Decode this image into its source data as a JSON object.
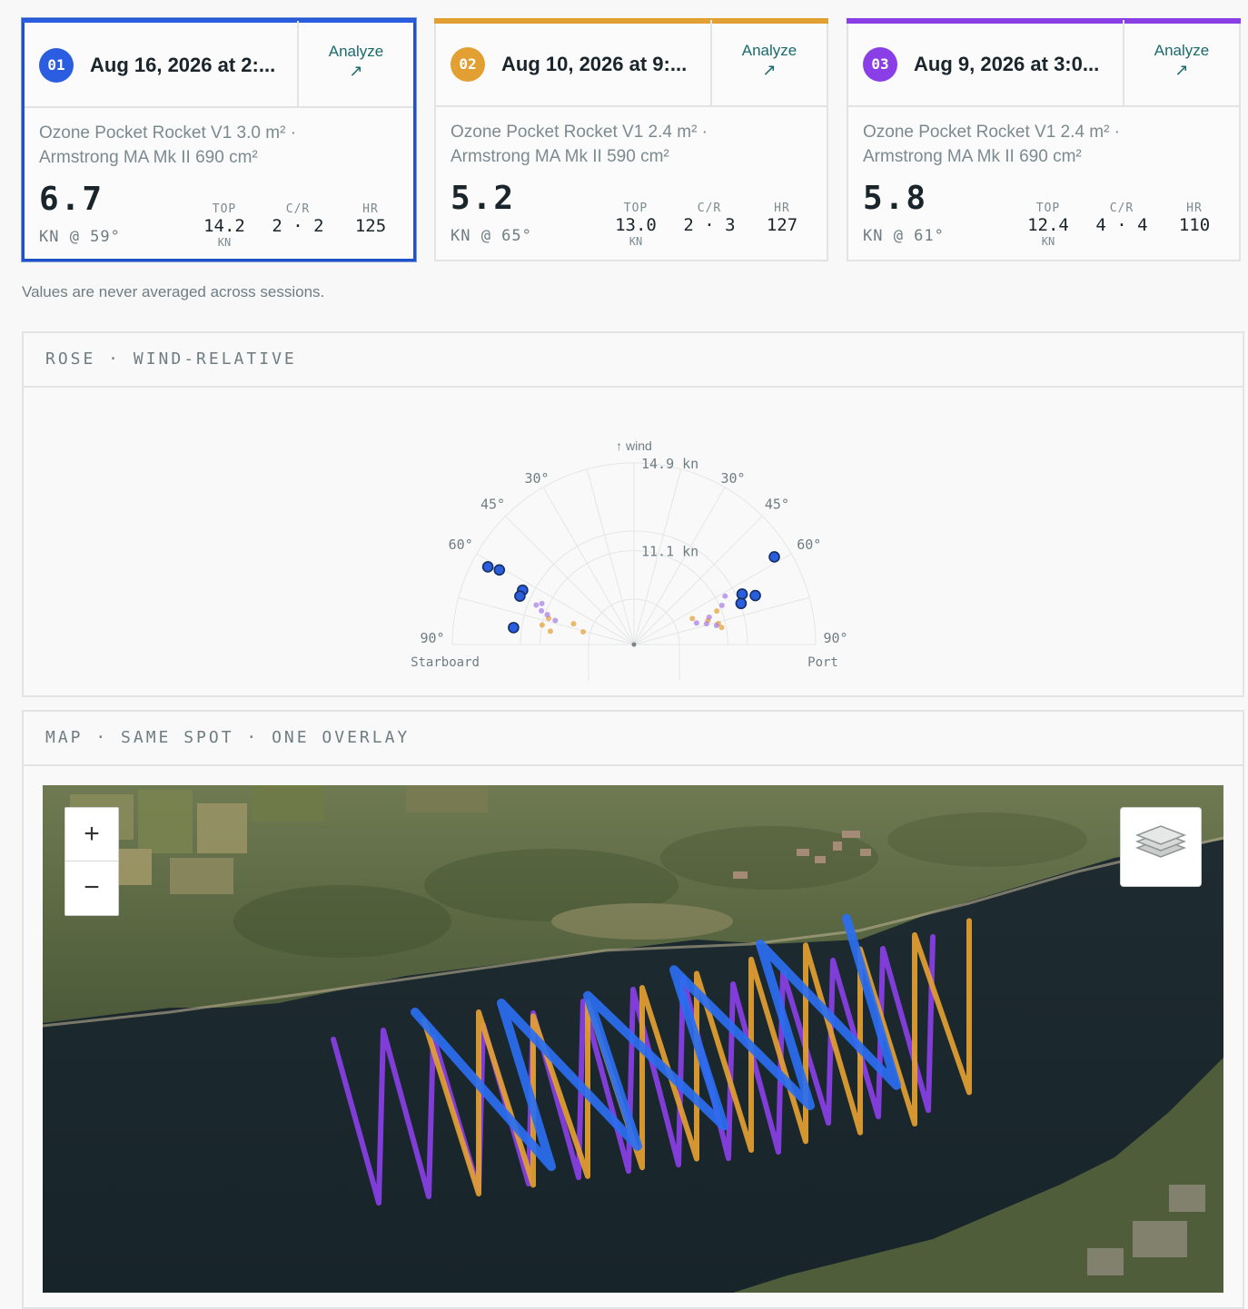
{
  "sessions": [
    {
      "num": "01",
      "date": "Aug 16, 2026 at 2:...",
      "analyze": "Analyze",
      "color": "#2a5de0",
      "gear_line1": "Ozone Pocket Rocket V1 3.0 m² ·",
      "gear_line2": "Armstrong MA Mk II 690 cm²",
      "speed": "6.7",
      "speed_sub": "KN @ 59°",
      "top_label": "TOP",
      "top_value": "14.2",
      "top_unit": "KN",
      "cr_label": "C/R",
      "cr_value": "2 · 2",
      "hr_label": "HR",
      "hr_value": "125",
      "selected": true
    },
    {
      "num": "02",
      "date": "Aug 10, 2026 at 9:...",
      "analyze": "Analyze",
      "color": "#e3a032",
      "gear_line1": "Ozone Pocket Rocket V1 2.4 m² ·",
      "gear_line2": "Armstrong MA Mk II 590 cm²",
      "speed": "5.2",
      "speed_sub": "KN @ 65°",
      "top_label": "TOP",
      "top_value": "13.0",
      "top_unit": "KN",
      "cr_label": "C/R",
      "cr_value": "2 · 3",
      "hr_label": "HR",
      "hr_value": "127",
      "selected": false
    },
    {
      "num": "03",
      "date": "Aug 9, 2026 at 3:0...",
      "analyze": "Analyze",
      "color": "#8a3fe6",
      "gear_line1": "Ozone Pocket Rocket V1 2.4 m² ·",
      "gear_line2": "Armstrong MA Mk II 690 cm²",
      "speed": "5.8",
      "speed_sub": "KN @ 61°",
      "top_label": "TOP",
      "top_value": "12.4",
      "top_unit": "KN",
      "cr_label": "C/R",
      "cr_value": "4 · 4",
      "hr_label": "HR",
      "hr_value": "110",
      "selected": false
    }
  ],
  "note": "Values are never averaged across sessions.",
  "rose": {
    "title": "ROSE · WIND-RELATIVE",
    "wind_label": "↑ wind",
    "ring_outer": "14.9 kn",
    "ring_inner": "11.1 kn",
    "angle_labels": [
      "30°",
      "45°",
      "60°",
      "90°"
    ],
    "starboard": "Starboard",
    "port": "Port"
  },
  "chart_data": {
    "type": "scatter",
    "title": "ROSE · WIND-RELATIVE",
    "angle_unit": "degrees off wind",
    "radial_unit": "kn",
    "radial_ticks": [
      11.1,
      14.9
    ],
    "series": [
      {
        "color": "#2a5de0",
        "points": [
          {
            "side": "starboard",
            "angle": 62,
            "speed": 14.2
          },
          {
            "side": "starboard",
            "angle": 61,
            "speed": 13.7
          },
          {
            "side": "starboard",
            "angle": 64,
            "speed": 12.4
          },
          {
            "side": "starboard",
            "angle": 67,
            "speed": 12.4
          },
          {
            "side": "starboard",
            "angle": 82,
            "speed": 12.3
          },
          {
            "side": "port",
            "angle": 58,
            "speed": 14.2
          },
          {
            "side": "port",
            "angle": 65,
            "speed": 12.2
          },
          {
            "side": "port",
            "angle": 68,
            "speed": 12.7
          },
          {
            "side": "port",
            "angle": 69,
            "speed": 12.0
          }
        ]
      },
      {
        "color": "#e3a032",
        "points": [
          {
            "side": "starboard",
            "angle": 73,
            "speed": 10.9
          },
          {
            "side": "starboard",
            "angle": 78,
            "speed": 11.1
          },
          {
            "side": "starboard",
            "angle": 81,
            "speed": 10.7
          },
          {
            "side": "starboard",
            "angle": 71,
            "speed": 9.8
          },
          {
            "side": "starboard",
            "angle": 76,
            "speed": 9.3
          },
          {
            "side": "port",
            "angle": 68,
            "speed": 10.9
          },
          {
            "side": "port",
            "angle": 72,
            "speed": 10.4
          },
          {
            "side": "port",
            "angle": 76,
            "speed": 10.8
          },
          {
            "side": "port",
            "angle": 79,
            "speed": 10.9
          },
          {
            "side": "port",
            "angle": 66,
            "speed": 9.8
          }
        ]
      },
      {
        "color": "#a77be6",
        "points": [
          {
            "side": "starboard",
            "angle": 68,
            "speed": 11.6
          },
          {
            "side": "starboard",
            "angle": 70,
            "speed": 11.3
          },
          {
            "side": "starboard",
            "angle": 71,
            "speed": 11.0
          },
          {
            "side": "starboard",
            "angle": 66,
            "speed": 11.4
          },
          {
            "side": "starboard",
            "angle": 73,
            "speed": 10.6
          },
          {
            "side": "port",
            "angle": 62,
            "speed": 11.5
          },
          {
            "side": "port",
            "angle": 66,
            "speed": 11.2
          },
          {
            "side": "port",
            "angle": 70,
            "speed": 10.5
          },
          {
            "side": "port",
            "angle": 74,
            "speed": 10.3
          },
          {
            "side": "port",
            "angle": 77,
            "speed": 10.7
          },
          {
            "side": "port",
            "angle": 71,
            "speed": 9.9
          }
        ]
      }
    ]
  },
  "map": {
    "title": "MAP · SAME SPOT · ONE OVERLAY",
    "zoom_in": "+",
    "zoom_out": "−",
    "track_colors": [
      "#8a3fe6",
      "#e3a032",
      "#2a6ef0"
    ]
  }
}
